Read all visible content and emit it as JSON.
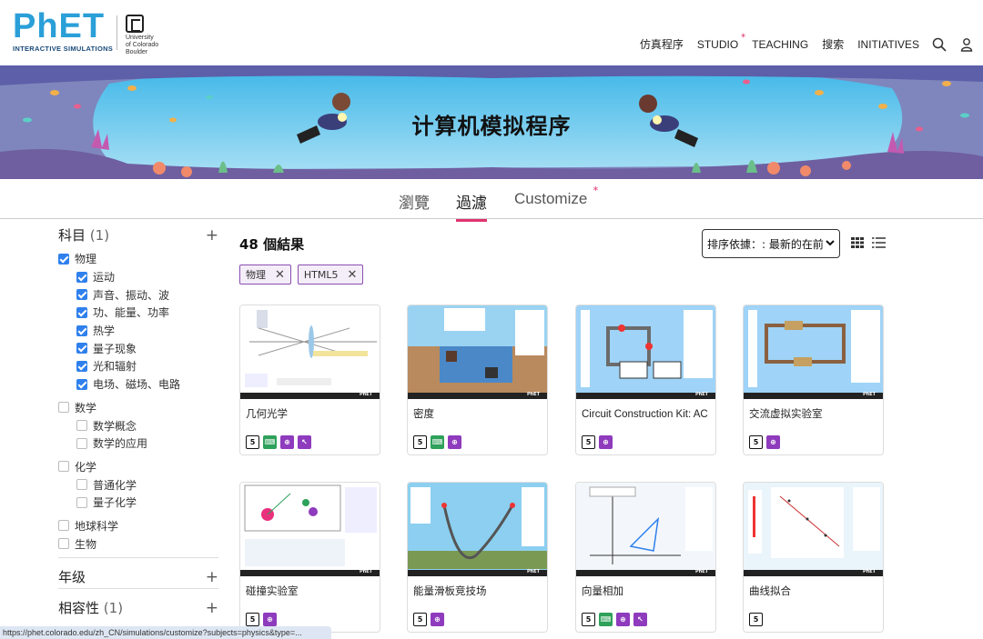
{
  "header": {
    "logo_text_main": "PhET",
    "logo_text_sub": "INTERACTIVE SIMULATIONS",
    "university": [
      "University",
      "of Colorado",
      "Boulder"
    ],
    "nav": [
      "仿真程序",
      "STUDIO",
      "TEACHING",
      "搜索",
      "INITIATIVES"
    ]
  },
  "banner": {
    "title": "计算机模拟程序"
  },
  "tabs": [
    "瀏覽",
    "過濾",
    "Customize"
  ],
  "sidebar": {
    "subject": {
      "label": "科目",
      "count": "(1)",
      "items": [
        {
          "label": "物理",
          "checked": true,
          "level": 0
        },
        {
          "label": "运动",
          "checked": true,
          "level": 1
        },
        {
          "label": "声音、振动、波",
          "checked": true,
          "level": 1
        },
        {
          "label": "功、能量、功率",
          "checked": true,
          "level": 1
        },
        {
          "label": "热学",
          "checked": true,
          "level": 1
        },
        {
          "label": "量子现象",
          "checked": true,
          "level": 1
        },
        {
          "label": "光和辐射",
          "checked": true,
          "level": 1
        },
        {
          "label": "电场、磁场、电路",
          "checked": true,
          "level": 1
        },
        {
          "label": "数学",
          "checked": false,
          "level": 0
        },
        {
          "label": "数学概念",
          "checked": false,
          "level": 1
        },
        {
          "label": "数学的应用",
          "checked": false,
          "level": 1
        },
        {
          "label": "化学",
          "checked": false,
          "level": 0
        },
        {
          "label": "普通化学",
          "checked": false,
          "level": 1
        },
        {
          "label": "量子化学",
          "checked": false,
          "level": 1
        },
        {
          "label": "地球科学",
          "checked": false,
          "level": 0
        },
        {
          "label": "生物",
          "checked": false,
          "level": 0
        }
      ]
    },
    "grade": {
      "label": "年级"
    },
    "compat": {
      "label": "相容性",
      "count": "(1)"
    }
  },
  "results": {
    "count_label": "48 個結果",
    "sort_label": "排序依據：: 最新的在前",
    "chips": [
      "物理",
      "HTML5"
    ]
  },
  "cards": [
    {
      "title": "几何光学",
      "badges": [
        "html5",
        "kb",
        "zoom",
        "inter"
      ]
    },
    {
      "title": "密度",
      "badges": [
        "html5",
        "kb",
        "zoom"
      ]
    },
    {
      "title": "Circuit Construction Kit: AC",
      "badges": [
        "html5",
        "zoom"
      ]
    },
    {
      "title": "交流虚拟实验室",
      "badges": [
        "html5",
        "zoom"
      ]
    },
    {
      "title": "碰撞实验室",
      "badges": [
        "html5",
        "zoom"
      ]
    },
    {
      "title": "能量滑板竞技场",
      "badges": [
        "html5",
        "zoom"
      ]
    },
    {
      "title": "向量相加",
      "badges": [
        "html5",
        "kb",
        "zoom",
        "inter"
      ]
    },
    {
      "title": "曲线拟合",
      "badges": [
        "html5"
      ]
    }
  ],
  "status_bar": {
    "url": "https://phet.colorado.edu/zh_CN/simulations/customize?subjects=physics&type=..."
  }
}
